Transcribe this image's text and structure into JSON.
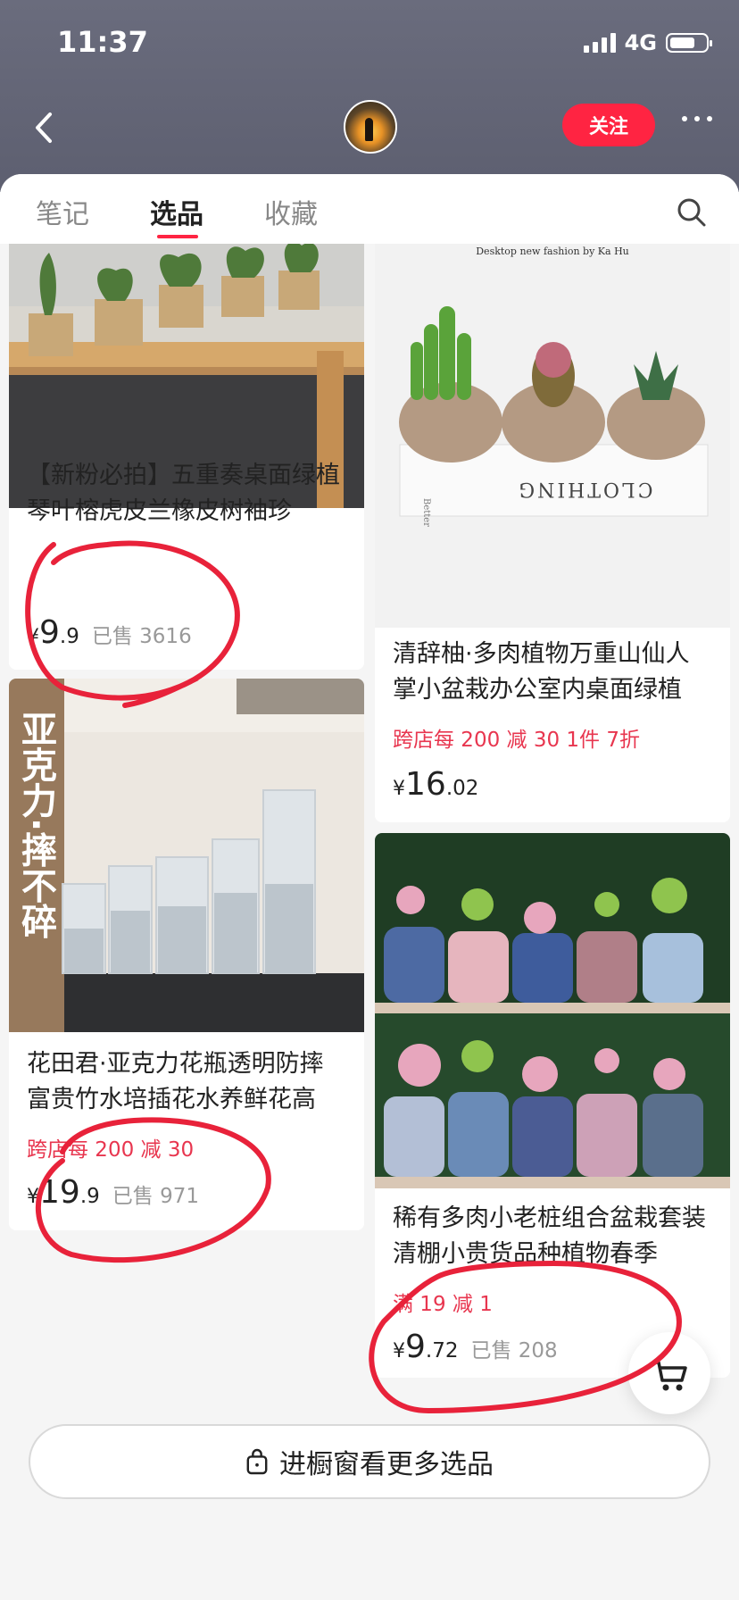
{
  "status": {
    "time": "11:37",
    "network": "4G",
    "battery_level": 0.7
  },
  "header": {
    "follow_label": "关注"
  },
  "tabs": [
    {
      "label": "笔记",
      "active": false
    },
    {
      "label": "选品",
      "active": true
    },
    {
      "label": "收藏",
      "active": false
    }
  ],
  "products": [
    {
      "title": "【新粉必拍】五重奏桌面绿植琴叶榕虎皮兰橡皮树袖珍",
      "promo": "",
      "price_int": "9",
      "price_dec": ".9",
      "sold": "已售 3616"
    },
    {
      "title": "清辞柚·多肉植物万重山仙人掌小盆栽办公室内桌面绿植",
      "promo": "跨店每 200 减 30   1件 7折",
      "price_int": "16",
      "price_dec": ".02",
      "sold": "",
      "image_text": {
        "header": "Desktop new fashion by Ka Hu",
        "book_spine": "Better",
        "book_title": "CLOTHING"
      }
    },
    {
      "title": "花田君·亚克力花瓶透明防摔富贵竹水培插花水养鲜花高",
      "promo": "跨店每 200 减 30",
      "price_int": "19",
      "price_dec": ".9",
      "sold": "已售 971",
      "image_banner": "亚克力·摔不碎"
    },
    {
      "title": "稀有多肉小老桩组合盆栽套装清棚小贵货品种植物春季",
      "promo": "满 19 减 1",
      "price_int": "9",
      "price_dec": ".72",
      "sold": "已售 208"
    }
  ],
  "currency_symbol": "¥",
  "footer": {
    "more_label": "进橱窗看更多选品"
  },
  "colors": {
    "accent": "#ff2442",
    "promo": "#e8364f",
    "annotation": "#e8223a",
    "header_bg": "#62647a"
  }
}
